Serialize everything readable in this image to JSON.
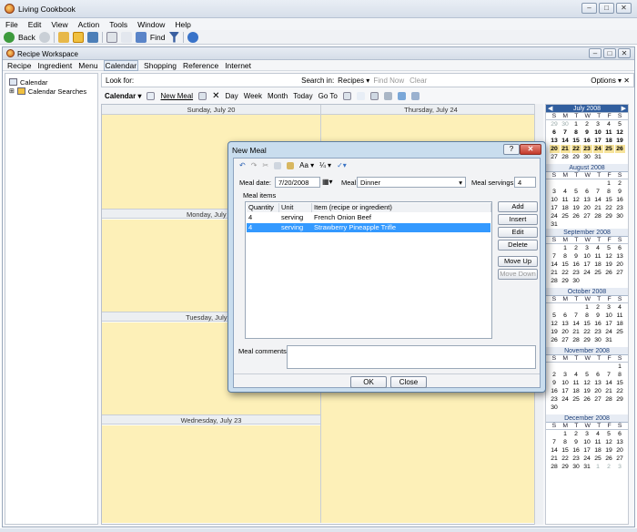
{
  "app": {
    "title": "Living Cookbook",
    "win_buttons": [
      "–",
      "□",
      "✕"
    ]
  },
  "menu": [
    "File",
    "Edit",
    "View",
    "Action",
    "Tools",
    "Window",
    "Help"
  ],
  "toolbar": {
    "back": "Back",
    "find": "Find"
  },
  "workspace": {
    "title": "Recipe Workspace",
    "menu": [
      "Recipe",
      "Ingredient",
      "Menu",
      "Calendar",
      "Shopping",
      "Reference",
      "Internet"
    ],
    "active_menu": "Calendar"
  },
  "tree": {
    "items": [
      "Calendar",
      "Calendar Searches"
    ]
  },
  "search": {
    "look_for": "Look for:",
    "search_in": "Search in:",
    "scope": "Recipes",
    "find_now": "Find Now",
    "clear": "Clear",
    "options": "Options"
  },
  "calbar": {
    "calendar": "Calendar",
    "new_meal": "New Meal",
    "day": "Day",
    "week": "Week",
    "month": "Month",
    "today": "Today",
    "goto": "Go To"
  },
  "days": {
    "sun": "Sunday, July 20",
    "thu": "Thursday, July 24",
    "mon": "Monday, July 21",
    "tue": "Tuesday, July 22",
    "wed": "Wednesday, July 23"
  },
  "months": [
    {
      "name": "July 2008",
      "rows": [
        [
          "29",
          "30",
          "1",
          "2",
          "3",
          "4",
          "5"
        ],
        [
          "6",
          "7",
          "8",
          "9",
          "10",
          "11",
          "12"
        ],
        [
          "13",
          "14",
          "15",
          "16",
          "17",
          "18",
          "19"
        ],
        [
          "20",
          "21",
          "22",
          "23",
          "24",
          "25",
          "26"
        ],
        [
          "27",
          "28",
          "29",
          "30",
          "31",
          "",
          ""
        ]
      ]
    },
    {
      "name": "August 2008",
      "rows": [
        [
          "",
          "",
          "",
          "",
          "",
          "1",
          "2"
        ],
        [
          "3",
          "4",
          "5",
          "6",
          "7",
          "8",
          "9"
        ],
        [
          "10",
          "11",
          "12",
          "13",
          "14",
          "15",
          "16"
        ],
        [
          "17",
          "18",
          "19",
          "20",
          "21",
          "22",
          "23"
        ],
        [
          "24",
          "25",
          "26",
          "27",
          "28",
          "29",
          "30"
        ],
        [
          "31",
          "",
          "",
          "",
          "",
          "",
          ""
        ]
      ]
    },
    {
      "name": "September 2008",
      "rows": [
        [
          "",
          "1",
          "2",
          "3",
          "4",
          "5",
          "6"
        ],
        [
          "7",
          "8",
          "9",
          "10",
          "11",
          "12",
          "13"
        ],
        [
          "14",
          "15",
          "16",
          "17",
          "18",
          "19",
          "20"
        ],
        [
          "21",
          "22",
          "23",
          "24",
          "25",
          "26",
          "27"
        ],
        [
          "28",
          "29",
          "30",
          "",
          "",
          "",
          ""
        ]
      ]
    },
    {
      "name": "October 2008",
      "rows": [
        [
          "",
          "",
          "",
          "1",
          "2",
          "3",
          "4"
        ],
        [
          "5",
          "6",
          "7",
          "8",
          "9",
          "10",
          "11"
        ],
        [
          "12",
          "13",
          "14",
          "15",
          "16",
          "17",
          "18"
        ],
        [
          "19",
          "20",
          "21",
          "22",
          "23",
          "24",
          "25"
        ],
        [
          "26",
          "27",
          "28",
          "29",
          "30",
          "31",
          ""
        ]
      ]
    },
    {
      "name": "November 2008",
      "rows": [
        [
          "",
          "",
          "",
          "",
          "",
          "",
          "1"
        ],
        [
          "2",
          "3",
          "4",
          "5",
          "6",
          "7",
          "8"
        ],
        [
          "9",
          "10",
          "11",
          "12",
          "13",
          "14",
          "15"
        ],
        [
          "16",
          "17",
          "18",
          "19",
          "20",
          "21",
          "22"
        ],
        [
          "23",
          "24",
          "25",
          "26",
          "27",
          "28",
          "29"
        ],
        [
          "30",
          "",
          "",
          "",
          "",
          "",
          ""
        ]
      ]
    },
    {
      "name": "December 2008",
      "rows": [
        [
          "",
          "1",
          "2",
          "3",
          "4",
          "5",
          "6"
        ],
        [
          "7",
          "8",
          "9",
          "10",
          "11",
          "12",
          "13"
        ],
        [
          "14",
          "15",
          "16",
          "17",
          "18",
          "19",
          "20"
        ],
        [
          "21",
          "22",
          "23",
          "24",
          "25",
          "26",
          "27"
        ],
        [
          "28",
          "29",
          "30",
          "31",
          "1",
          "2",
          "3"
        ]
      ]
    }
  ],
  "dow": [
    "S",
    "M",
    "T",
    "W",
    "T",
    "F",
    "S"
  ],
  "dialog": {
    "title": "New Meal",
    "meal_date_label": "Meal date:",
    "meal_date": "7/20/2008",
    "meal_label": "Meal:",
    "meal": "Dinner",
    "servings_label": "Meal servings:",
    "servings": "4",
    "items_label": "Meal items",
    "columns": [
      "Quantity",
      "Unit",
      "Item (recipe or ingredient)"
    ],
    "rows": [
      {
        "qty": "4",
        "unit": "serving",
        "item": "French Onion Beef"
      },
      {
        "qty": "4",
        "unit": "serving",
        "item": "Strawberry Pineapple Trifle"
      }
    ],
    "buttons": {
      "add": "Add",
      "insert": "Insert",
      "edit": "Edit",
      "delete": "Delete",
      "move_up": "Move Up",
      "move_down": "Move Down"
    },
    "comments_label": "Meal comments:",
    "ok": "OK",
    "close": "Close",
    "format_label": "Aa"
  }
}
